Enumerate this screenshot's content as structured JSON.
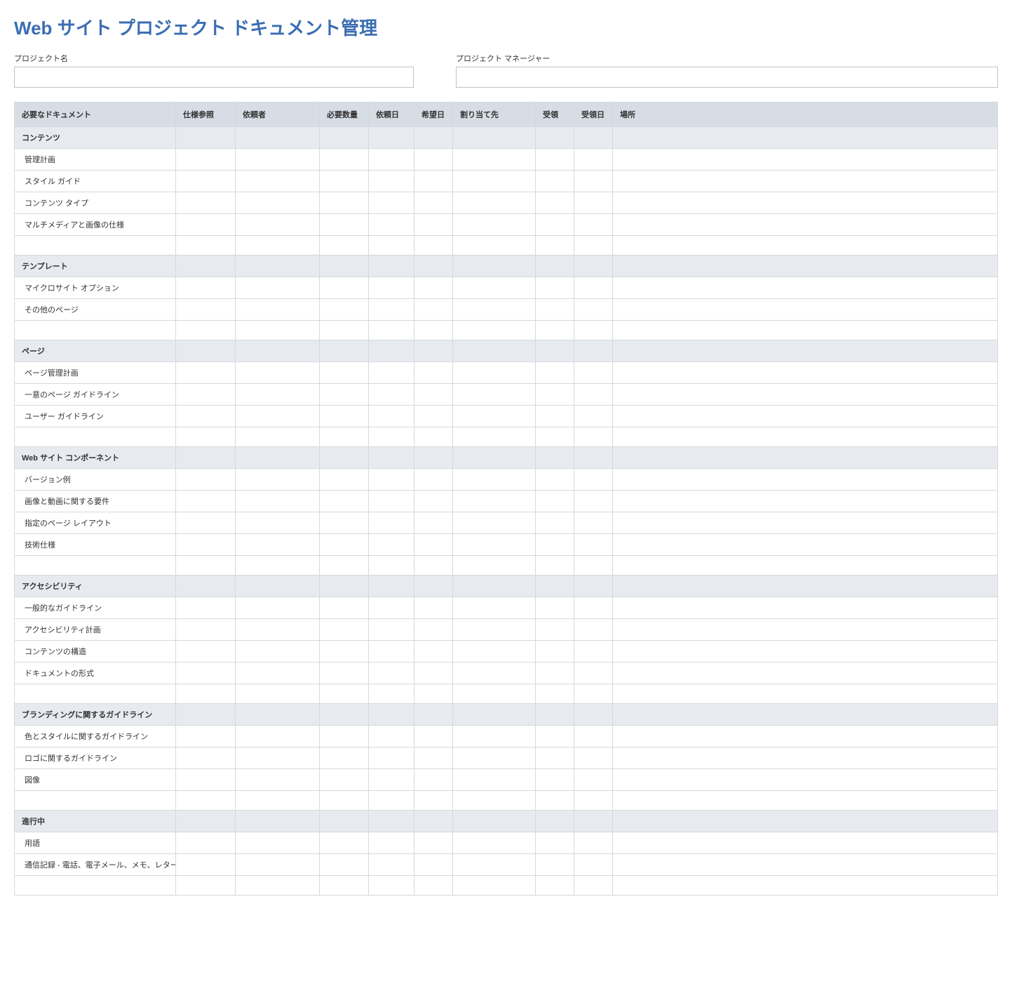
{
  "title": "Web サイト プロジェクト ドキュメント管理",
  "fields": {
    "projectName": {
      "label": "プロジェクト名",
      "value": ""
    },
    "projectManager": {
      "label": "プロジェクト マネージャー",
      "value": ""
    }
  },
  "columns": [
    "必要なドキュメント",
    "仕様参照",
    "依頼者",
    "必要数量",
    "依頼日",
    "希望日",
    "割り当て先",
    "受領",
    "受領日",
    "場所"
  ],
  "sections": [
    {
      "name": "コンテンツ",
      "rows": [
        {
          "doc": "管理計画"
        },
        {
          "doc": "スタイル ガイド"
        },
        {
          "doc": "コンテンツ タイプ"
        },
        {
          "doc": "マルチメディアと画像の仕様"
        }
      ],
      "trailingEmpty": 1
    },
    {
      "name": "テンプレート",
      "rows": [
        {
          "doc": "マイクロサイト オプション"
        },
        {
          "doc": "その他のページ"
        }
      ],
      "trailingEmpty": 1
    },
    {
      "name": "ページ",
      "rows": [
        {
          "doc": "ページ管理計画"
        },
        {
          "doc": "一意のページ ガイドライン"
        },
        {
          "doc": "ユーザー ガイドライン"
        }
      ],
      "trailingEmpty": 1
    },
    {
      "name": "Web サイト コンポーネント",
      "rows": [
        {
          "doc": "バージョン例"
        },
        {
          "doc": "画像と動画に関する要件"
        },
        {
          "doc": "指定のページ レイアウト"
        },
        {
          "doc": "技術仕様"
        }
      ],
      "trailingEmpty": 1
    },
    {
      "name": "アクセシビリティ",
      "rows": [
        {
          "doc": "一般的なガイドライン"
        },
        {
          "doc": "アクセシビリティ計画"
        },
        {
          "doc": "コンテンツの構造"
        },
        {
          "doc": "ドキュメントの形式"
        }
      ],
      "trailingEmpty": 1
    },
    {
      "name": "ブランディングに関するガイドライン",
      "rows": [
        {
          "doc": "色とスタイルに関するガイドライン"
        },
        {
          "doc": "ロゴに関するガイドライン"
        },
        {
          "doc": "図像"
        }
      ],
      "trailingEmpty": 1
    },
    {
      "name": "進行中",
      "rows": [
        {
          "doc": "用語"
        },
        {
          "doc": "通信記録 - 電話、電子メール、メモ、レター"
        }
      ],
      "trailingEmpty": 1
    }
  ]
}
